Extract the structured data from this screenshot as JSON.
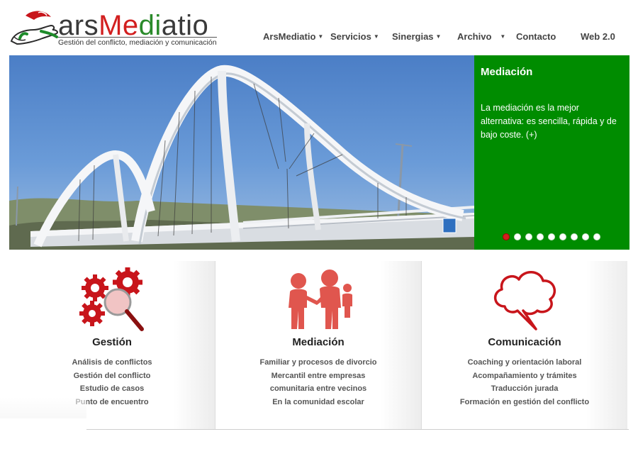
{
  "brand": {
    "name_part1": "ars",
    "name_part2": "Me",
    "name_part3": "di",
    "name_part4": "atio",
    "tagline": "Gestión del conflicto, mediación y comunicación",
    "colors": {
      "red": "#d21f1f",
      "green": "#008c00"
    }
  },
  "nav": {
    "items": [
      {
        "label": "ArsMediatio",
        "has_caret": true,
        "icon": "chevron-down-icon"
      },
      {
        "label": "Servicios",
        "has_caret": true,
        "icon": "chevron-down-icon"
      },
      {
        "label": "Sinergias",
        "has_caret": true,
        "icon": "chevron-down-icon"
      },
      {
        "label": "Archivo",
        "has_caret": true,
        "icon": "chevron-down-icon"
      },
      {
        "label": "Contacto",
        "has_caret": false
      },
      {
        "label": "Web 2.0",
        "has_caret": false
      }
    ]
  },
  "slider": {
    "image_subject": "white arch bridge under blue sky",
    "title": "Mediación",
    "text": "La mediación es la mejor alternativa: es sencilla, rápida y de bajo coste. (+)",
    "dot_count": 9,
    "active_dot": 1,
    "panel_color": "#008c00"
  },
  "columns": [
    {
      "icon": "gears-magnifier-icon",
      "title": "Gestión",
      "items": [
        "Análisis de conflictos",
        "Gestión del conflicto",
        "Estudio de casos",
        "Punto de encuentro"
      ]
    },
    {
      "icon": "people-handshake-icon",
      "title": "Mediación",
      "items": [
        "Familiar y procesos de divorcio",
        "Mercantil entre empresas",
        "comunitaria entre vecinos",
        "En la comunidad escolar"
      ]
    },
    {
      "icon": "speech-cloud-icon",
      "title": "Comunicación",
      "items": [
        "Coaching y orientación laboral",
        "Acompañamiento y trámites",
        "Traducción jurada",
        "Formación en gestión del conflicto"
      ]
    }
  ]
}
